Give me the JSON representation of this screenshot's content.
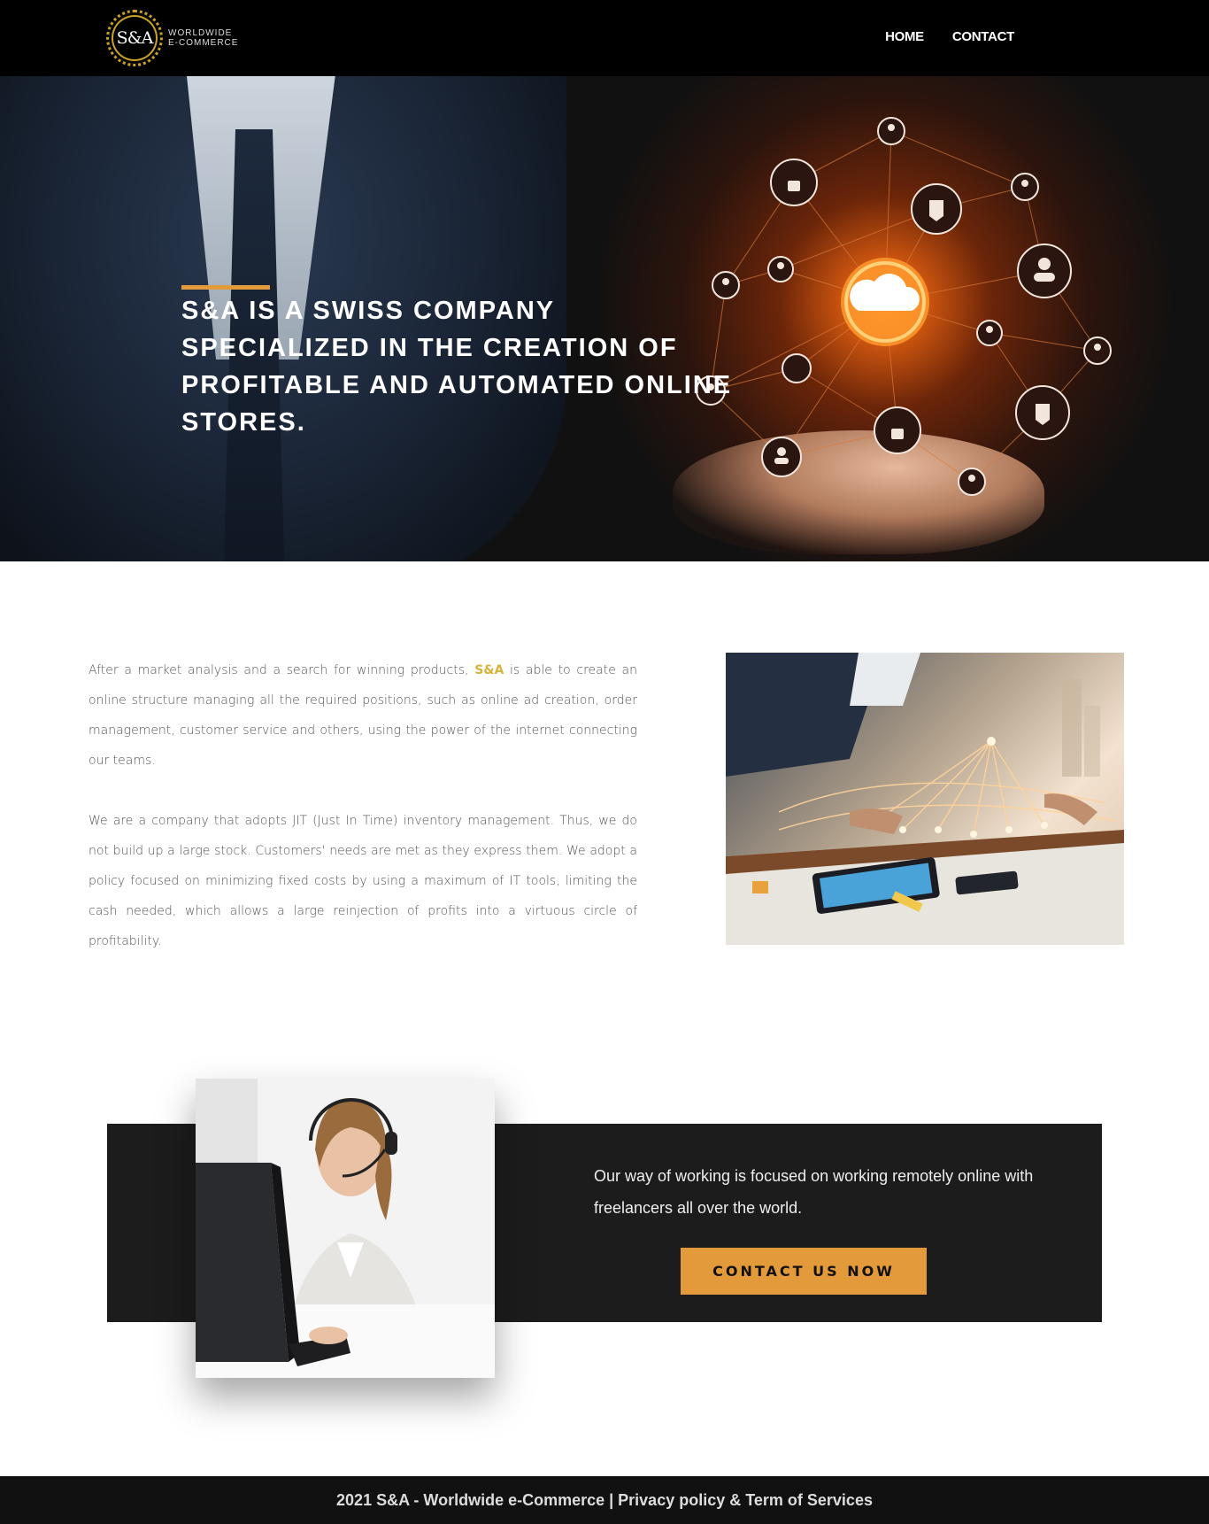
{
  "header": {
    "logo_monogram": "S&A",
    "logo_line1": "WORLDWIDE",
    "logo_line2": "E-COMMERCE",
    "nav": [
      {
        "label": "HOME"
      },
      {
        "label": "CONTACT"
      }
    ]
  },
  "hero": {
    "brand": "S&A",
    "title_rest": " IS A SWISS COMPANY SPECIALIZED IN THE CREATION OF PROFITABLE AND AUTOMATED ONLINE STORES."
  },
  "about": {
    "p1_before": "After a market analysis and a search for winning products, ",
    "p1_brand": "S&A",
    "p1_after": " is able to create an online structure managing all the required positions, such as online ad creation, order management, customer service and others, using the power of the internet connecting our teams.",
    "p2": "We are a company that adopts JIT (Just In Time) inventory management. Thus, we do not build up a large stock. Customers' needs are met as they express them. We adopt a policy focused on minimizing fixed costs by using a maximum of IT tools, limiting the cash needed, which allows a large reinjection of profits into a virtuous circle of profitability."
  },
  "cta": {
    "text": "Our way of working is focused on working remotely online with freelancers all over the world.",
    "button_label": "CONTACT US NOW"
  },
  "footer": {
    "text": "2021 S&A - Worldwide e-Commerce | Privacy policy & Term of Services"
  },
  "colors": {
    "accent": "#e29a3a",
    "brand_gold": "#d8b23a",
    "header_bg": "#000000",
    "cta_bg": "#1c1c1c"
  }
}
